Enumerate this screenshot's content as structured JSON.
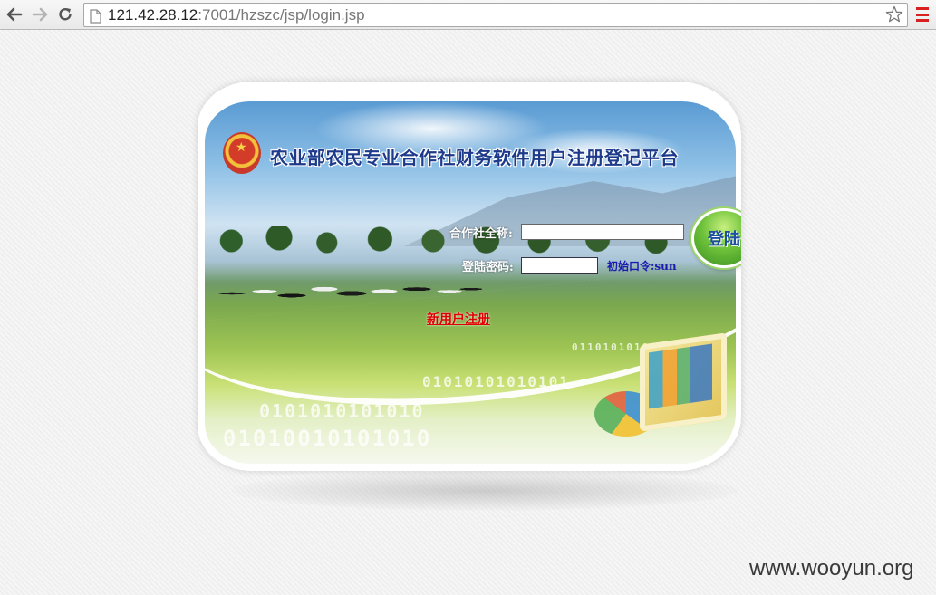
{
  "browser": {
    "url_host": "121.42.28.12",
    "url_path": ":7001/hzszc/jsp/login.jsp",
    "icons": {
      "back": "arrow-left-icon",
      "forward": "arrow-right-icon",
      "reload": "reload-icon",
      "page": "page-icon",
      "bookmark": "star-icon",
      "menu": "hamburger-menu-icon"
    }
  },
  "header": {
    "title": "农业部农民专业合作社财务软件用户注册登记平台",
    "emblem_icon": "national-emblem-icon"
  },
  "login_form": {
    "cooperative_label": "合作社全称:",
    "cooperative_value": "",
    "password_label": "登陆密码:",
    "password_value": "",
    "initial_password_hint": "初始口令:sun",
    "login_button_label": "登陆",
    "register_link_label": "新用户注册"
  },
  "decor": {
    "binary_1": "0110101010101",
    "binary_2": "01010101010101",
    "binary_3": "0101010101010",
    "binary_4": "01010010101010"
  },
  "watermark": "www.wooyun.org",
  "colors": {
    "title": "#1e3a8a",
    "register_link": "#e00000",
    "hint": "#1b1bb0",
    "menu_icon": "#d82020"
  }
}
